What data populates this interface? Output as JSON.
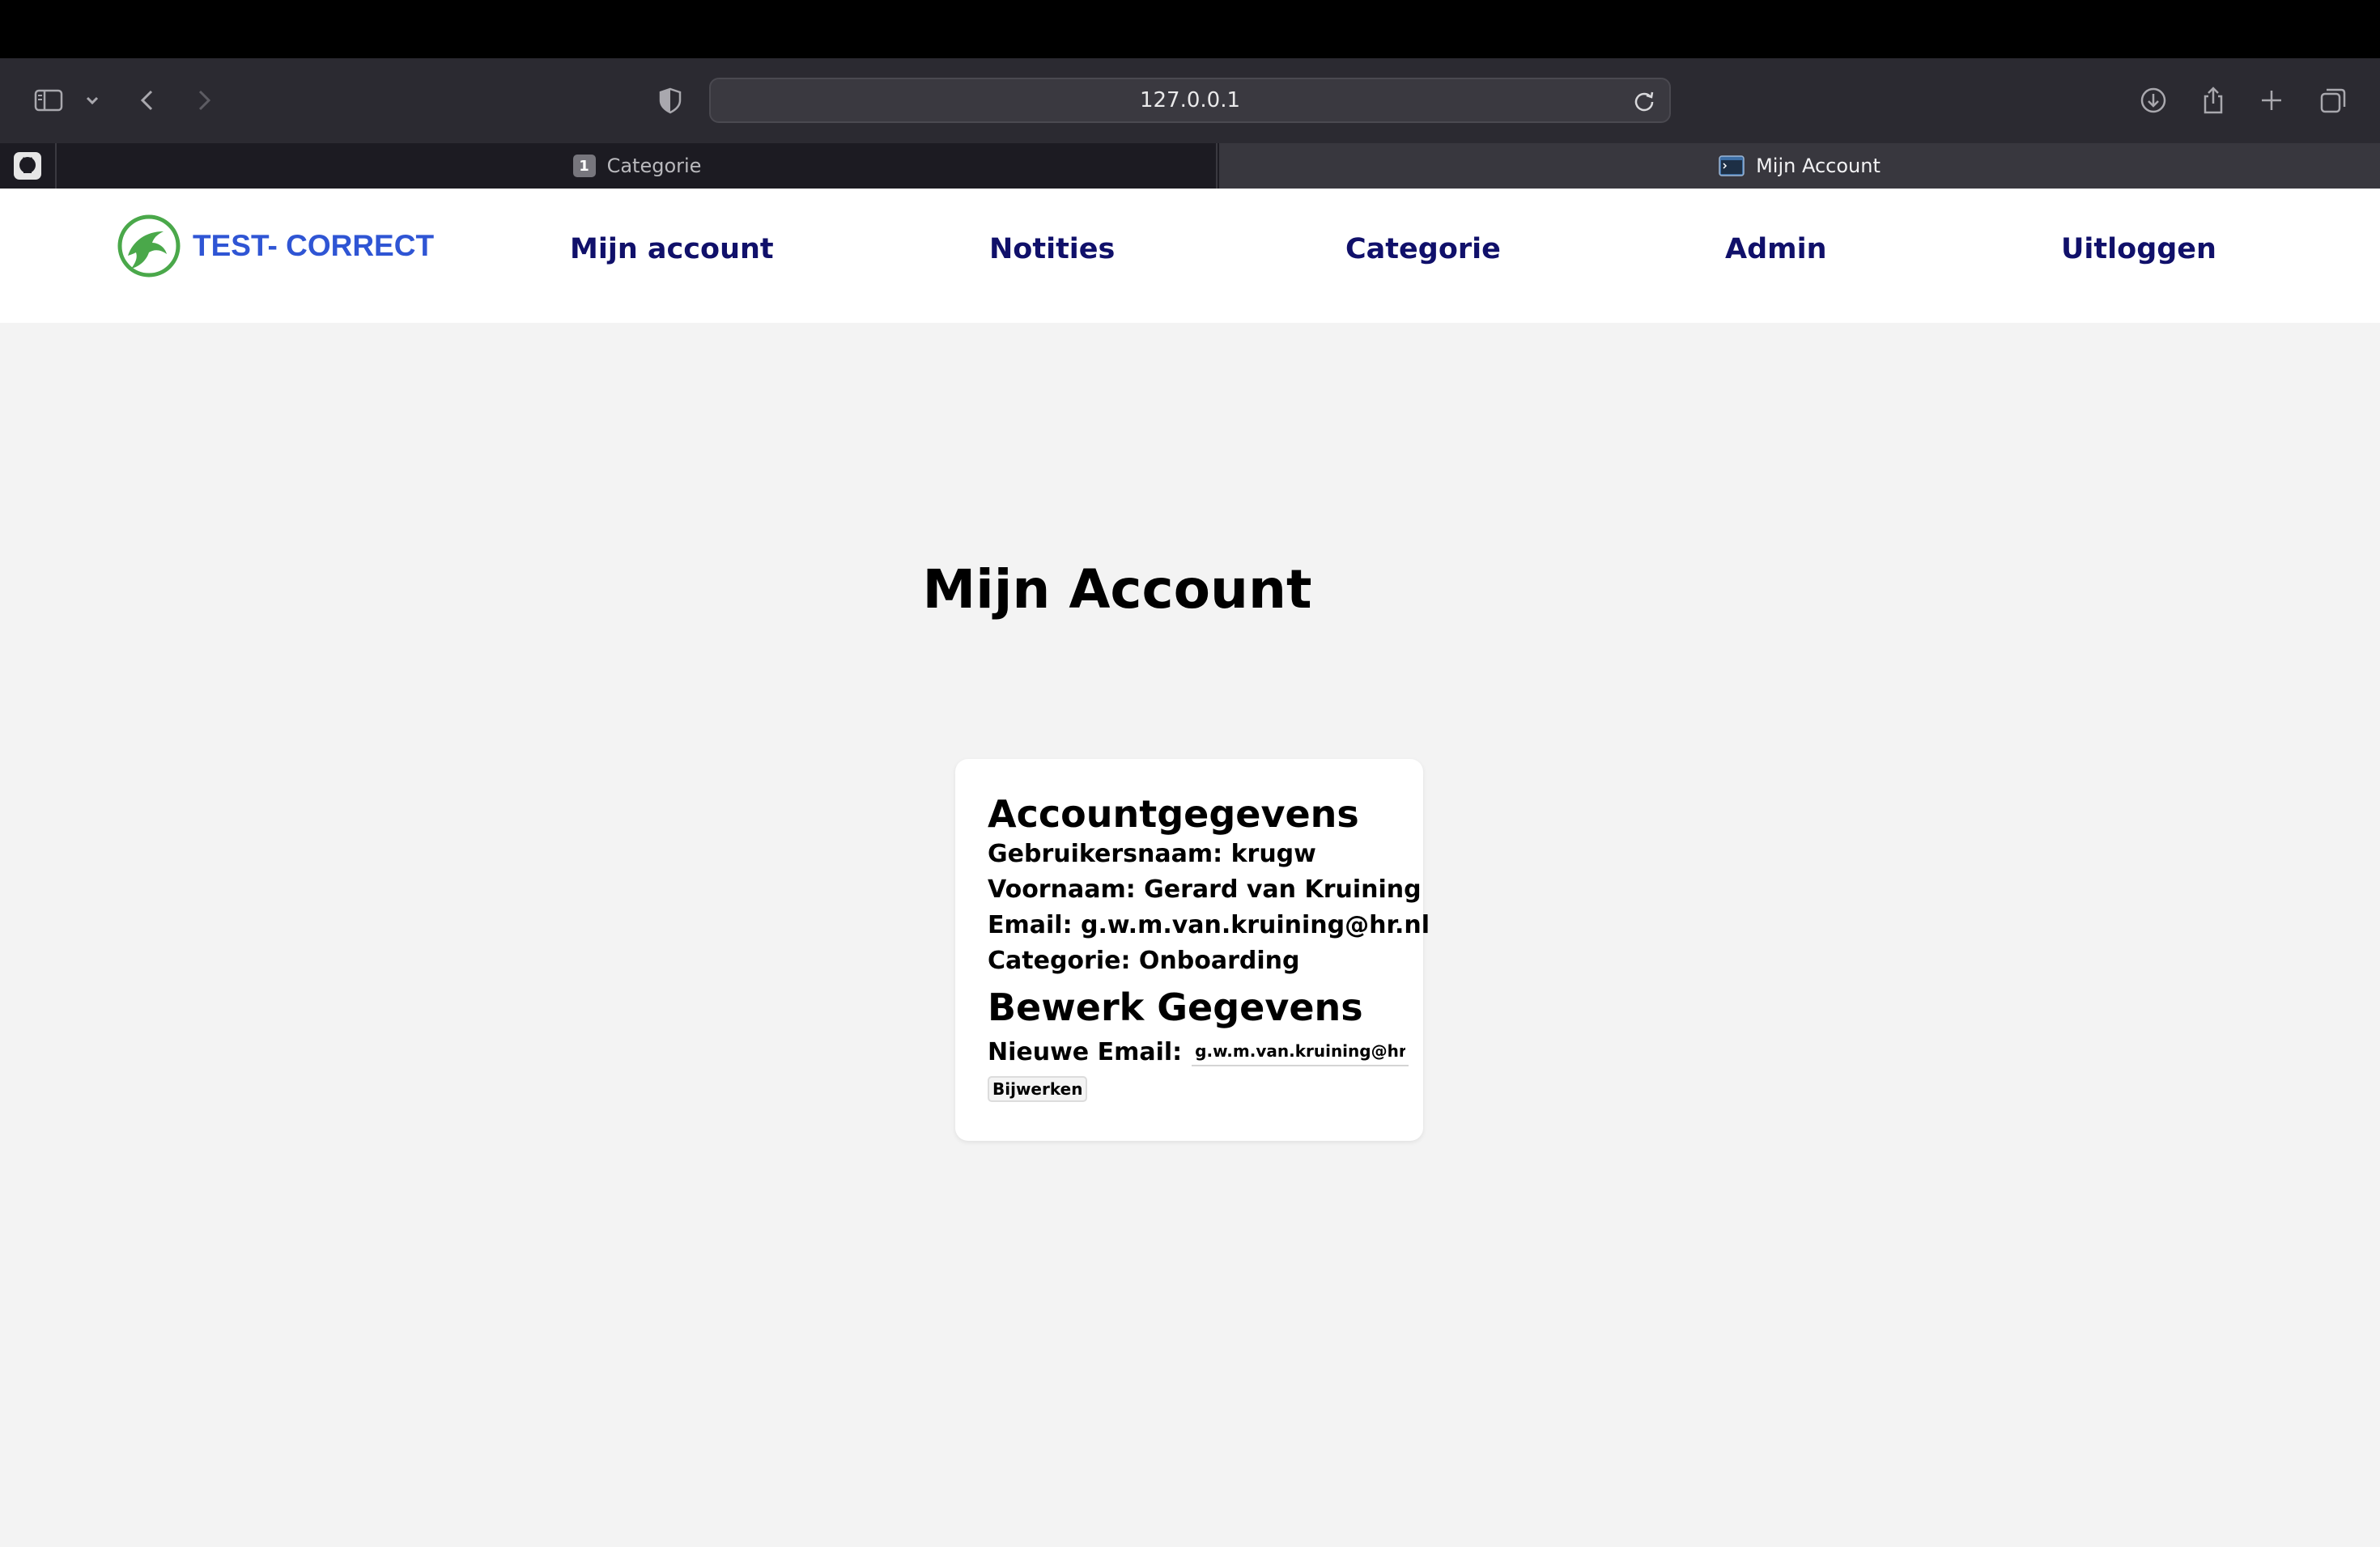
{
  "browser": {
    "url": "127.0.0.1",
    "tabs": [
      {
        "label": "Categorie",
        "badge": "1",
        "active": false
      },
      {
        "label": "Mijn Account",
        "active": true
      }
    ],
    "icons": [
      "sidebar-icon",
      "chevron-down-icon",
      "back-icon",
      "forward-icon",
      "shield-icon",
      "reload-icon",
      "download-icon",
      "share-icon",
      "new-tab-icon",
      "tabs-overview-icon",
      "github-icon"
    ]
  },
  "site": {
    "logo_text": "TEST- CORRECT",
    "nav": {
      "account": "Mijn account",
      "notes": "Notities",
      "category": "Categorie",
      "admin": "Admin",
      "logout": "Uitloggen"
    },
    "colors": {
      "nav": "#10106a",
      "logo_text": "#2f55d4",
      "logo_green": "#4aa84a",
      "page_bg": "#f3f3f3"
    }
  },
  "page": {
    "title": "Mijn Account",
    "card": {
      "heading": "Accountgegevens",
      "username_row": "Gebruikersnaam: krugw",
      "firstname_row": "Voornaam: Gerard van Kruining",
      "email_row": "Email: g.w.m.van.kruining@hr.nl",
      "category_row": "Categorie: Onboarding",
      "edit_heading": "Bewerk Gegevens",
      "new_email_label": "Nieuwe Email:",
      "new_email_value": "g.w.m.van.kruining@hr.n",
      "update_label": "Bijwerken"
    }
  }
}
